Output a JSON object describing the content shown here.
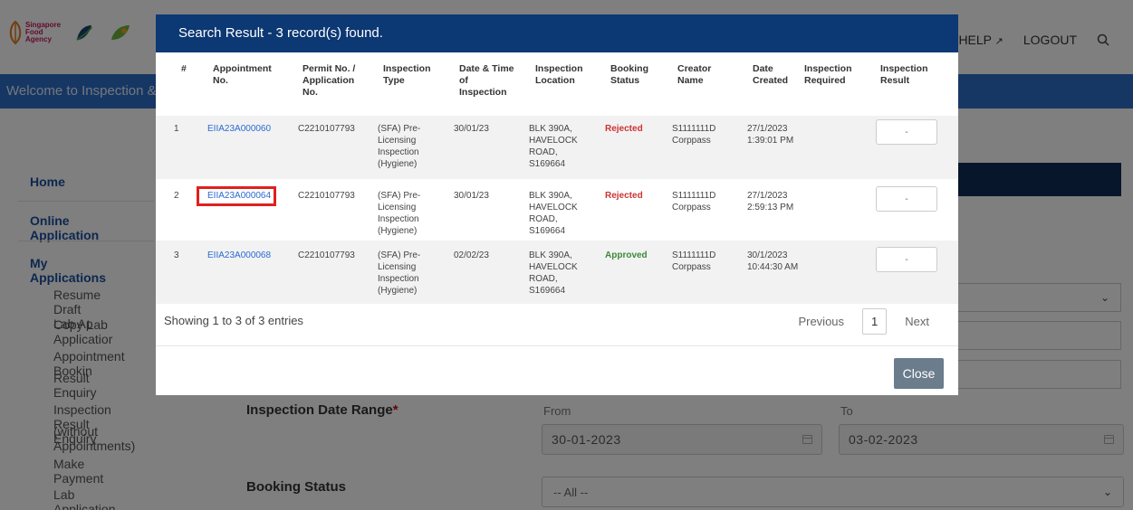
{
  "header": {
    "sfa_logo_text": [
      "Singapore",
      "Food",
      "Agency"
    ],
    "help_label": "HELP",
    "logout_label": "LOGOUT",
    "welcome": "Welcome to Inspection &"
  },
  "sidebar": {
    "home": "Home",
    "online_application": "Online Application",
    "my_applications": "My Applications",
    "items": [
      "Resume Draft Lab Ap",
      "Copy Lab Applicatior",
      "Appointment Bookin",
      "Result Enquiry",
      "Inspection Result Enquiry",
      "(without Appointments)",
      "Make Payment",
      "Lab Application Status"
    ]
  },
  "form": {
    "date_range_label": "Inspection Date Range",
    "required_mark": "*",
    "from_label": "From",
    "to_label": "To",
    "from_value": "30-01-2023",
    "to_value": "03-02-2023",
    "booking_status_label": "Booking Status",
    "booking_status_value": "-- All --"
  },
  "modal": {
    "title": "Search Result - 3 record(s) found.",
    "columns": [
      [
        "#"
      ],
      [
        "Appointment",
        "No."
      ],
      [
        "Permit No. /",
        "Application",
        "No."
      ],
      [
        "Inspection",
        "Type"
      ],
      [
        "Date & Time",
        "of",
        "Inspection"
      ],
      [
        "Inspection",
        "Location"
      ],
      [
        "Booking",
        "Status"
      ],
      [
        "Creator",
        "Name"
      ],
      [
        "Date",
        "Created"
      ],
      [
        "Inspection",
        "Required"
      ],
      [
        "Inspection",
        "Result"
      ]
    ],
    "rows": [
      {
        "num": "1",
        "appointment_no": "EIIA23A000060",
        "permit_no": "C2210107793",
        "type": [
          "(SFA) Pre-",
          "Licensing",
          "Inspection",
          "(Hygiene)"
        ],
        "date": "30/01/23",
        "location": [
          "BLK 390A,",
          "HAVELOCK",
          "ROAD,",
          "S169664"
        ],
        "status": "Rejected",
        "creator": [
          "S1111111D",
          "Corppass"
        ],
        "created": [
          "27/1/2023",
          "1:39:01 PM"
        ],
        "required": "",
        "result": "-"
      },
      {
        "num": "2",
        "appointment_no": "EIIA23A000064",
        "permit_no": "C2210107793",
        "type": [
          "(SFA) Pre-",
          "Licensing",
          "Inspection",
          "(Hygiene)"
        ],
        "date": "30/01/23",
        "location": [
          "BLK 390A,",
          "HAVELOCK",
          "ROAD,",
          "S169664"
        ],
        "status": "Rejected",
        "creator": [
          "S1111111D",
          "Corppass"
        ],
        "created": [
          "27/1/2023",
          "2:59:13 PM"
        ],
        "required": "",
        "result": "-"
      },
      {
        "num": "3",
        "appointment_no": "EIIA23A000068",
        "permit_no": "C2210107793",
        "type": [
          "(SFA) Pre-",
          "Licensing",
          "Inspection",
          "(Hygiene)"
        ],
        "date": "02/02/23",
        "location": [
          "BLK 390A,",
          "HAVELOCK",
          "ROAD,",
          "S169664"
        ],
        "status": "Approved",
        "creator": [
          "S1111111D",
          "Corppass"
        ],
        "created": [
          "30/1/2023",
          "10:44:30 AM"
        ],
        "required": "",
        "result": "-"
      }
    ],
    "showing": "Showing 1 to 3 of 3 entries",
    "previous": "Previous",
    "current_page": "1",
    "next": "Next",
    "close": "Close"
  },
  "colors": {
    "modal_header": "#0c3873",
    "blue_bar": "#2d6ec8",
    "link": "#2a6ad2",
    "rejected": "#cc3333",
    "approved": "#3a8a3a",
    "highlight": "#e0201e"
  }
}
